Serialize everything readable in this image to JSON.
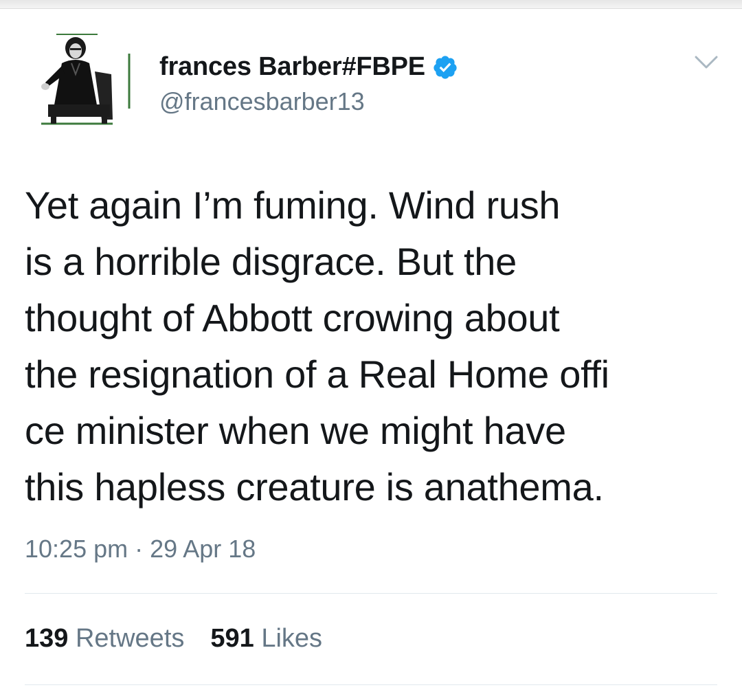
{
  "user": {
    "display_name": "frances Barber#FBPE",
    "handle": "@francesbarber13",
    "verified": true
  },
  "tweet": {
    "lines": [
      "Yet again I’m fuming. Wind rush",
      "is a horrible disgrace. But the",
      "thought of Abbott crowing about",
      "the resignation of a Real Home offi",
      "ce minister when we might have",
      "this hapless creature is anathema."
    ],
    "time": "10:25 pm",
    "separator": "·",
    "date": "29 Apr 18"
  },
  "stats": {
    "retweets_count": "139",
    "retweets_label": "Retweets",
    "likes_count": "591",
    "likes_label": "Likes"
  },
  "icons": {
    "verified": "verified-badge-icon",
    "caret": "chevron-down-icon"
  },
  "colors": {
    "verified_blue": "#1da1f2",
    "secondary_text": "#657786",
    "primary_text": "#14171a"
  }
}
